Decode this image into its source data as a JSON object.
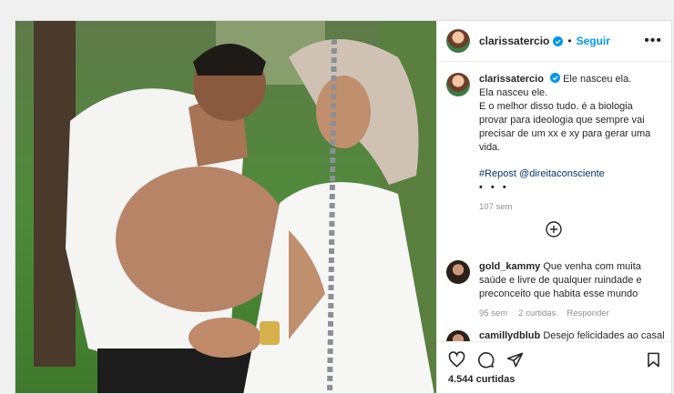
{
  "header": {
    "username": "clarissatercio",
    "separator": "•",
    "follow_label": "Seguir",
    "more_label": "•••"
  },
  "caption": {
    "username": "clarissatercio",
    "line1": "Ele nasceu ela.",
    "line2": "Ela nasceu ele.",
    "line3": "E o melhor disso tudo. é a biologia provar para ideologia que sempre vai precisar de um xx e xy para gerar uma vida.",
    "repost": "#Repost @direitaconsciente",
    "ellipsis": "• • •",
    "time": "107 sem"
  },
  "comments": [
    {
      "username": "gold_kammy",
      "text": "Que venha com muita saúde e livre de qualquer ruindade e preconceito que habita esse mundo",
      "time": "95 sem",
      "likes": "2 curtidas",
      "reply": "Responder"
    },
    {
      "username": "camillydblub",
      "text": "Desejo felicidades ao casal"
    }
  ],
  "footer": {
    "likes": "4.544 curtidas"
  },
  "icons": [
    "verified-badge-icon",
    "load-more-comments-icon",
    "heart-icon",
    "comment-icon",
    "share-icon",
    "bookmark-icon"
  ],
  "colors": {
    "accent": "#0095f6",
    "text": "#262626",
    "muted": "#8e8e8e",
    "hashtag": "#00376b"
  }
}
